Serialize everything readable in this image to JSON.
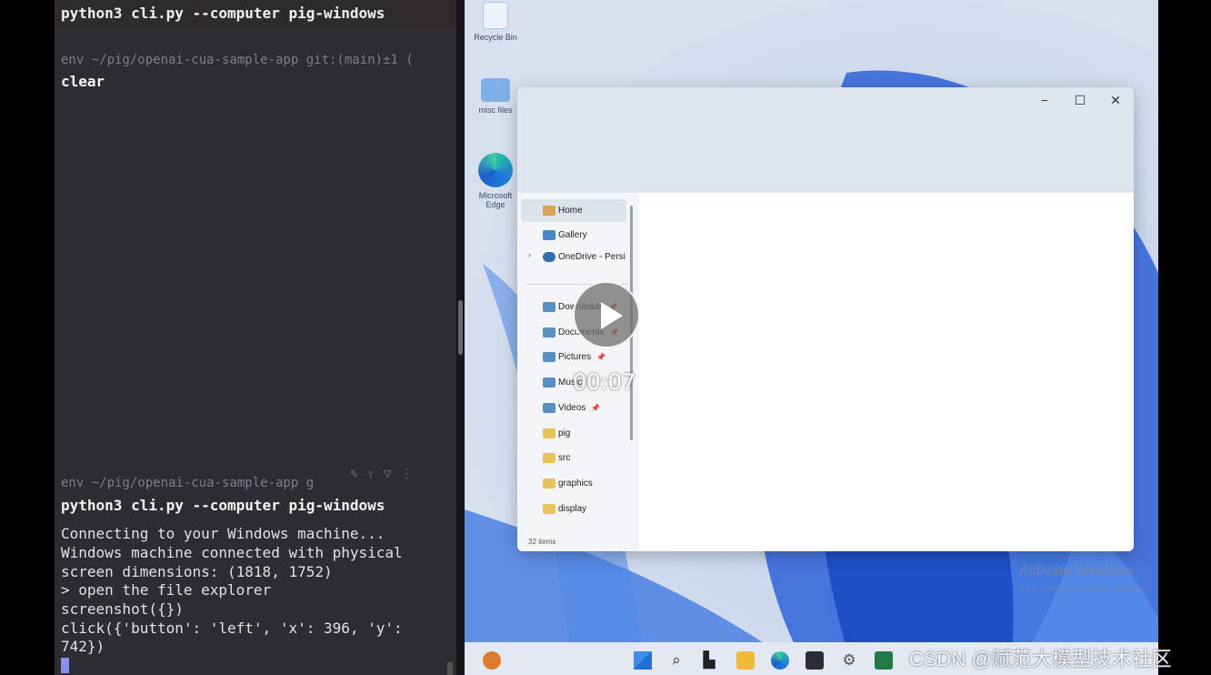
{
  "terminal": {
    "title": "python3 cli.py --computer pig-windows",
    "prompt_1": "env ~/pig/openai-cua-sample-app git:(main)±1 (",
    "cmd_1": "clear",
    "prompt_2": "env ~/pig/openai-cua-sample-app g",
    "cmd_2": "python3 cli.py --computer pig-windows",
    "output": [
      "Connecting to your Windows machine...",
      "Windows machine connected with physical",
      "screen dimensions: (1818, 1752)",
      "> open the file explorer",
      "screenshot({})",
      "click({'button': 'left', 'x': 396, 'y':",
      "742})"
    ],
    "tool_icons": "✎⇪▽⋮"
  },
  "desktop_icons": [
    {
      "label": "Recycle Bin",
      "icon": "recycle-bin-icon"
    },
    {
      "label": "misc files",
      "icon": "folder-icon"
    },
    {
      "label": "Microsoft Edge",
      "icon": "edge-icon"
    }
  ],
  "explorer": {
    "window_controls": {
      "minimize": "−",
      "maximize": "☐",
      "close": "✕"
    },
    "nav_items": [
      {
        "label": "Home",
        "color": "#d6a35a"
      },
      {
        "label": "Gallery",
        "color": "#4a86c8"
      },
      {
        "label": "OneDrive - Persi",
        "color": "#2f6fb5"
      },
      {
        "label": "Downloads",
        "color": "#5a8fc4"
      },
      {
        "label": "Documents",
        "color": "#5a8fc4"
      },
      {
        "label": "Pictures",
        "color": "#5a8fc4"
      },
      {
        "label": "Music",
        "color": "#5a8fc4"
      },
      {
        "label": "Videos",
        "color": "#5a8fc4"
      },
      {
        "label": "pig",
        "color": "#e8c35a"
      },
      {
        "label": "src",
        "color": "#e8c35a"
      },
      {
        "label": "graphics",
        "color": "#e8c35a"
      },
      {
        "label": "display",
        "color": "#e8c35a"
      }
    ],
    "status": "32 items",
    "pin_glyph": "📌"
  },
  "player": {
    "time": "00:07"
  },
  "activation": {
    "title": "Activate Windows",
    "subtitle": "Go to Settings to activate Windows."
  },
  "taskbar": {
    "icons": [
      "start-icon",
      "search-icon",
      "task-view-icon",
      "file-explorer-icon",
      "edge-icon",
      "terminal-icon",
      "settings-icon",
      "excel-icon"
    ]
  },
  "watermark": "CSDN @赋范大模型技术社区",
  "colors": {
    "terminal_bg": "#2b2d33",
    "accent_blue": "#2f6fe0"
  }
}
